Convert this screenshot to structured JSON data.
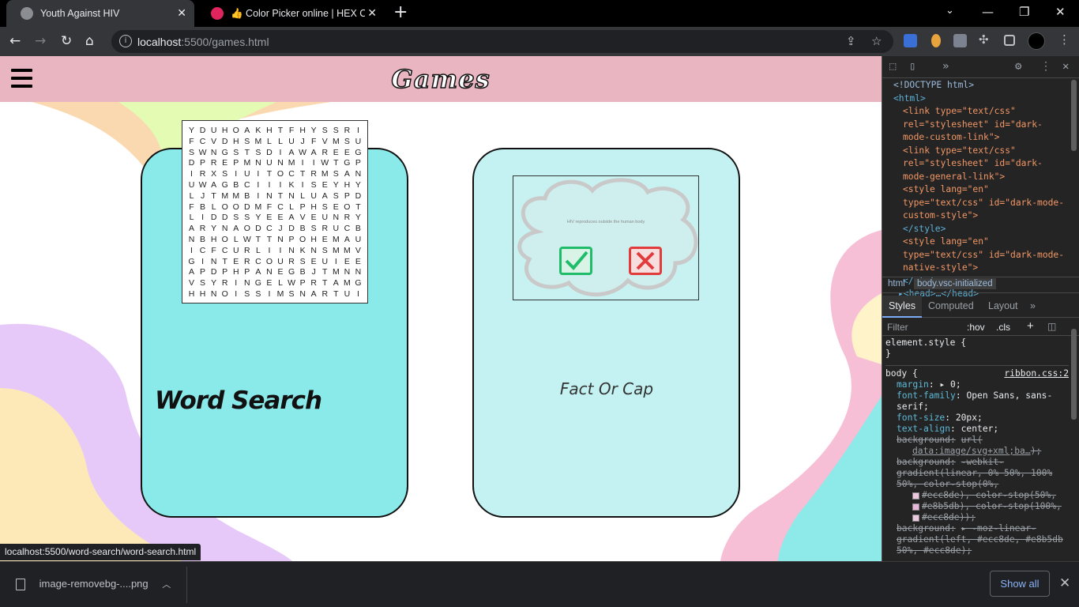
{
  "browser": {
    "tabs": [
      {
        "title": "Youth Against HIV",
        "active": true
      },
      {
        "title": "👍 Color Picker online | HEX Colo",
        "active": false
      }
    ],
    "new_tab_symbol": "+",
    "url_host": "localhost",
    "url_path": ":5500/games.html",
    "window_controls": {
      "minimize": "—",
      "maximize": "❐",
      "close": "✕"
    },
    "status_url": "localhost:5500/word-search/word-search.html"
  },
  "page": {
    "title": "Games",
    "colors": {
      "header": "#e8b5c0",
      "card_word_search": "#8ae9e9",
      "card_fact_or_cap": "#c4f2f2"
    },
    "word_search": {
      "label": "Word Search",
      "grid": [
        "YDUHOAKHTFHYSSRI",
        "FCVDHSMLLUJFVMSU",
        "SWNGSTSDIAWAREEG",
        "DPREPMNUNMIIWTGP",
        "IRXSIUITOCTRMSAN",
        "UWAGBCIIIKISEYHY",
        "LJTMMBINTNLUASPD",
        "FBLOODMFCLPHSEOT",
        "LIDDSSYEEAVEUNRY",
        "ARYNAODCJDBSRUCB",
        "NBHOLWTTNPOHEMAU",
        "ICFCURLIINKNSMMV",
        "GINTERCOURSEUIEE",
        "APDPHPANEGBJTMNN",
        "VSYRINGELWPRTAMG",
        "HHNOISSIMSNARTUI"
      ]
    },
    "fact_or_cap": {
      "label": "Fact Or Cap",
      "statement": "HIV reproduces outside the human body"
    }
  },
  "devtools": {
    "tabs_more": "»",
    "dom_lines": [
      "<!DOCTYPE html>",
      "<html>",
      "<link type=\"text/css\" rel=\"stylesheet\" id=\"dark-mode-custom-link\">",
      "<link type=\"text/css\" rel=\"stylesheet\" id=\"dark-mode-general-link\">",
      "<style lang=\"en\" type=\"text/css\" id=\"dark-mode-custom-style\">",
      "</style>",
      "<style lang=\"en\" type=\"text/css\" id=\"dark-mode-native-style\">",
      "</style>",
      "▸<head>…</head>"
    ],
    "breadcrumb_1": "html",
    "breadcrumb_2": "body.vsc-initialized",
    "panel_tabs": [
      "Styles",
      "Computed",
      "Layout",
      "»"
    ],
    "filter_placeholder": "Filter",
    "hov": ":hov",
    "cls": ".cls",
    "element_style": "element.style {",
    "close_brace": "}",
    "body_selector": "body {",
    "body_source": "ribbon.css:2",
    "rules": [
      {
        "prop": "margin",
        "value": "▸ 0;"
      },
      {
        "prop": "font-family",
        "value": "Open Sans, sans-serif;"
      },
      {
        "prop": "font-size",
        "value": "20px;"
      },
      {
        "prop": "text-align",
        "value": "center;"
      }
    ],
    "bg_url": "url(",
    "bg_url_data": "data:image/svg+xml;ba…",
    "bg_url_end": ");",
    "webkit_gradient": "-webkit-gradient(linear, 0% 50%, 100% 50%, color-stop(0%,",
    "stop_1": "#ecc8de), color-stop(50%,",
    "stop_2": "#e8b5db), color-stop(100%,",
    "stop_3": "#ecc8de));",
    "moz_gradient": "▸ -moz-linear-gradient(left, #ecc8de, #e8b5db 50%, #ecc8de);"
  },
  "downloads": {
    "file": "image-removebg-....png",
    "show_all": "Show all"
  }
}
